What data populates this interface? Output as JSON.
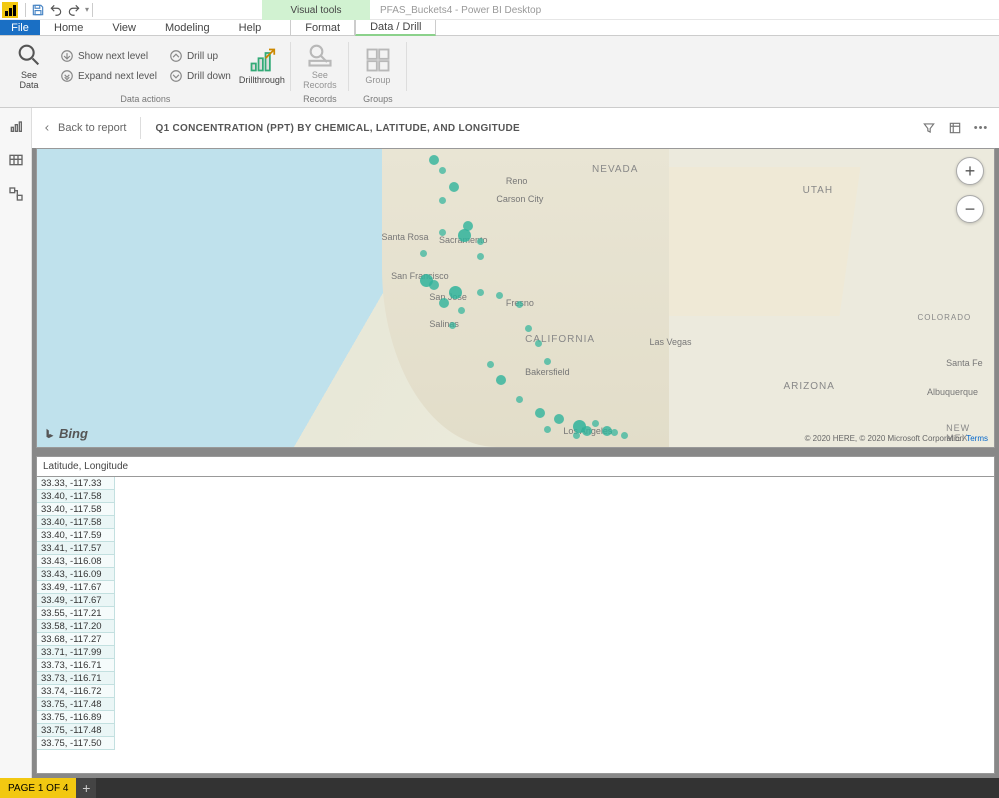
{
  "app": {
    "title": "PFAS_Buckets4 - Power BI Desktop",
    "visual_tools": "Visual tools"
  },
  "tabs": {
    "file": "File",
    "home": "Home",
    "view": "View",
    "modeling": "Modeling",
    "help": "Help",
    "format": "Format",
    "data_drill": "Data / Drill"
  },
  "ribbon": {
    "see_data": "See\nData",
    "show_next_level": "Show next level",
    "drill_up": "Drill up",
    "expand_next_level": "Expand next level",
    "drill_down": "Drill down",
    "drillthrough": "Drillthrough",
    "data_actions_label": "Data actions",
    "see_records": "See\nRecords",
    "records_label": "Records",
    "group": "Group",
    "groups_label": "Groups"
  },
  "crumb": {
    "back": "Back to report",
    "title": "Q1 CONCENTRATION (PPT) BY CHEMICAL, LATITUDE, AND LONGITUDE"
  },
  "map": {
    "labels": {
      "nevada": "NEVADA",
      "utah": "UTAH",
      "california": "CALIFORNIA",
      "arizona": "ARIZONA",
      "colorado": "COLORADO",
      "newmex": "NEW MEX"
    },
    "cities": {
      "reno": "Reno",
      "carson": "Carson City",
      "santarosa": "Santa Rosa",
      "sacramento": "Sacramento",
      "sf": "San Francisco",
      "sj": "San Jose",
      "fresno": "Fresno",
      "salinas": "Salinas",
      "bakersfield": "Bakersfield",
      "la": "Los Angeles",
      "vegas": "Las Vegas",
      "santafe": "Santa Fe",
      "albuq": "Albuquerque"
    },
    "attrib": "© 2020 HERE, © 2020 Microsoft Corporation",
    "terms": "Terms",
    "bing": "Bing",
    "zoom_in": "+",
    "zoom_out": "−"
  },
  "table": {
    "header": "Latitude, Longitude",
    "rows": [
      "33.33, -117.33",
      "33.40, -117.58",
      "33.40, -117.58",
      "33.40, -117.58",
      "33.40, -117.59",
      "33.41, -117.57",
      "33.43, -116.08",
      "33.43, -116.09",
      "33.49, -117.67",
      "33.49, -117.67",
      "33.55, -117.21",
      "33.58, -117.20",
      "33.68, -117.27",
      "33.71, -117.99",
      "33.73, -116.71",
      "33.73, -116.71",
      "33.74, -116.72",
      "33.75, -117.48",
      "33.75, -116.89",
      "33.75, -117.48",
      "33.75, -117.50"
    ]
  },
  "footer": {
    "page": "PAGE 1 OF 4",
    "add": "+"
  }
}
